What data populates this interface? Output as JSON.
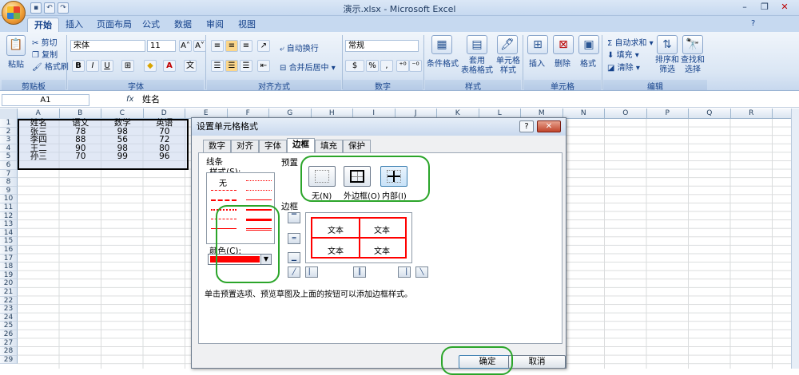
{
  "window": {
    "title": "演示.xlsx - Microsoft Excel",
    "minimize": "–",
    "restore": "❐",
    "close": "✕",
    "help": "?"
  },
  "ribbon_tabs": [
    "开始",
    "插入",
    "页面布局",
    "公式",
    "数据",
    "审阅",
    "视图"
  ],
  "clipboard": {
    "paste": "粘贴",
    "cut": "剪切",
    "copy": "复制",
    "format_painter": "格式刷",
    "group": "剪贴板"
  },
  "font": {
    "name": "宋体",
    "size": "11",
    "group": "字体",
    "bold": "B",
    "italic": "I",
    "underline": "U",
    "grow": "A˄",
    "shrink": "A˅",
    "color_font": "A",
    "phonetic": "文",
    "fill": "◆",
    "border": "⊞"
  },
  "alignment": {
    "wrap": "自动换行",
    "merge": "合并后居中",
    "group": "对齐方式"
  },
  "number": {
    "format": "常规",
    "currency": "$",
    "percent": "%",
    "comma": ",",
    "group": "数字"
  },
  "styles": {
    "conditional": "条件格式",
    "table": "套用\n表格格式",
    "cell": "单元格\n样式",
    "group": "样式"
  },
  "cells": {
    "insert": "插入",
    "delete": "删除",
    "format": "格式",
    "group": "单元格"
  },
  "editing": {
    "autosum": "自动求和",
    "fill": "填充",
    "clear": "清除",
    "sort": "排序和\n筛选",
    "find": "查找和\n选择",
    "group": "编辑"
  },
  "formula_bar": {
    "name_box": "A1",
    "fx": "fx",
    "value": "姓名"
  },
  "columns": [
    "A",
    "B",
    "C",
    "D",
    "E",
    "F",
    "G",
    "H",
    "I",
    "J",
    "K",
    "L",
    "M",
    "N",
    "O",
    "P",
    "Q",
    "R"
  ],
  "rows": [
    "1",
    "2",
    "3",
    "4",
    "5",
    "6",
    "7",
    "8",
    "9",
    "10",
    "11",
    "12",
    "13",
    "14",
    "15",
    "16",
    "17",
    "18",
    "19",
    "20",
    "21",
    "22",
    "23",
    "24",
    "25",
    "26",
    "27",
    "28",
    "29"
  ],
  "table": [
    [
      "姓名",
      "语文",
      "数学",
      "英语"
    ],
    [
      "张三",
      "78",
      "98",
      "70"
    ],
    [
      "李四",
      "88",
      "56",
      "72"
    ],
    [
      "王二",
      "90",
      "98",
      "80"
    ],
    [
      "孙三",
      "70",
      "99",
      "96"
    ]
  ],
  "dialog": {
    "title": "设置单元格格式",
    "tabs": [
      "数字",
      "对齐",
      "字体",
      "边框",
      "填充",
      "保护"
    ],
    "active_tab": "边框",
    "line_section": "线条",
    "style_label": "样式(S):",
    "none_style": "无",
    "color_label": "颜色(C):",
    "color_value": "#ff0000",
    "presets_label": "预置",
    "presets": [
      "无(N)",
      "外边框(O)",
      "内部(I)"
    ],
    "border_label": "边框",
    "preview_text": "文本",
    "hint": "单击预置选项、预览草图及上面的按钮可以添加边框样式。",
    "ok": "确定",
    "cancel": "取消",
    "help": "?",
    "close": "✕"
  },
  "highlight_color": "#2ba52a",
  "border_color": "#ff0000"
}
